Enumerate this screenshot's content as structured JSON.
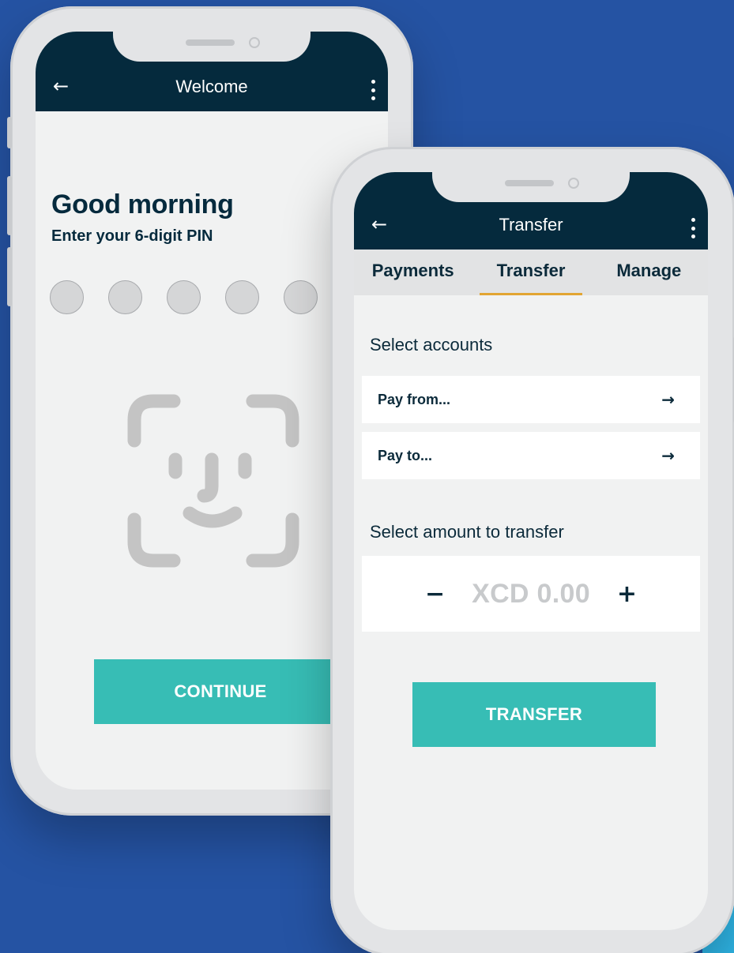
{
  "welcome_screen": {
    "appbar": {
      "back_icon": "arrow-left-icon",
      "title": "Welcome",
      "menu_icon": "more-vertical-icon"
    },
    "greeting": "Good morning",
    "pin_prompt": "Enter your 6-digit PIN",
    "pin_dots_visible": 5,
    "face_id_icon": "face-id-icon",
    "continue_label": "CONTINUE"
  },
  "transfer_screen": {
    "appbar": {
      "back_icon": "arrow-left-icon",
      "title": "Transfer",
      "menu_icon": "more-vertical-icon"
    },
    "tabs": [
      {
        "label": "Payments",
        "active": false
      },
      {
        "label": "Transfer",
        "active": true
      },
      {
        "label": "Manage",
        "active": false
      }
    ],
    "select_accounts_label": "Select accounts",
    "pay_from_label": "Pay from...",
    "pay_to_label": "Pay to...",
    "select_amount_label": "Select amount to transfer",
    "decrement_symbol": "−",
    "amount_value": "XCD 0.00",
    "increment_symbol": "+",
    "transfer_label": "TRANSFER"
  },
  "colors": {
    "background": "#2553a3",
    "appbar": "#052a3d",
    "primary_button": "#37bdb5",
    "tab_indicator": "#e2a532"
  }
}
